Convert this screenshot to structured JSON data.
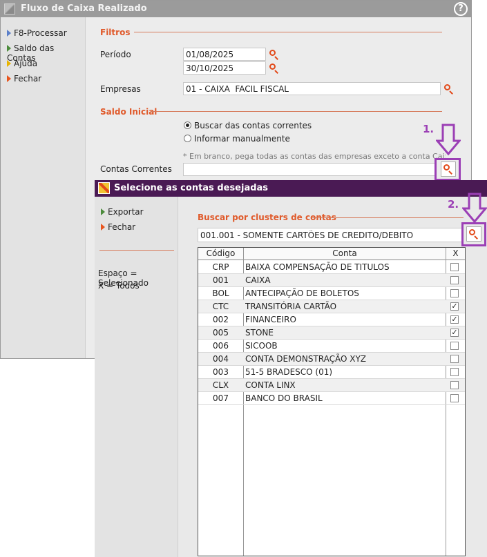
{
  "main": {
    "title": "Fluxo de Caixa Realizado",
    "help": "?",
    "sidebar": [
      {
        "label": "F8-Processar",
        "color": "#5b7fc9"
      },
      {
        "label": "Saldo das Contas",
        "color": "#4b8b3b"
      },
      {
        "label": "Ajuda",
        "color": "#e8b400"
      },
      {
        "label": "Fechar",
        "color": "#e8551e"
      }
    ],
    "filtros_title": "Filtros",
    "periodo_label": "Período",
    "data_inicio": "01/08/2025",
    "data_fim": "30/10/2025",
    "empresas_label": "Empresas",
    "empresas_value": "01 - CAIXA  FACIL FISCAL",
    "saldo_title": "Saldo Inicial",
    "radio_buscar": "Buscar das contas correntes",
    "radio_informar": "Informar manualmente",
    "hint": "* Em branco, pega todas as contas das empresas exceto a conta Caixa",
    "contas_label": "Contas Correntes",
    "contas_value": ""
  },
  "annotations": {
    "step1": "1.",
    "step2": "2."
  },
  "dialog": {
    "title": "Selecione as contas desejadas",
    "sidebar": [
      {
        "label": "Exportar",
        "color": "#4b8b3b"
      },
      {
        "label": "Fechar",
        "color": "#e8551e"
      }
    ],
    "legend_selected": "Espaço = Selecionado",
    "legend_all": "X = Todos",
    "cluster_title": "Buscar por clusters de contas",
    "cluster_value": "001.001 - SOMENTE CARTÕES DE CREDITO/DEBITO",
    "columns": {
      "code": "Código",
      "name": "Conta",
      "check": "X"
    },
    "rows": [
      {
        "code": "CRP",
        "name": "BAIXA COMPENSAÇÃO DE TITULOS",
        "checked": false
      },
      {
        "code": "001",
        "name": "CAIXA",
        "checked": false
      },
      {
        "code": "BOL",
        "name": "ANTECIPAÇÃO DE BOLETOS",
        "checked": false
      },
      {
        "code": "CTC",
        "name": "TRANSITÓRIA CARTÃO",
        "checked": true
      },
      {
        "code": "002",
        "name": "FINANCEIRO",
        "checked": true
      },
      {
        "code": "005",
        "name": "STONE",
        "checked": true
      },
      {
        "code": "006",
        "name": "SICOOB",
        "checked": false
      },
      {
        "code": "004",
        "name": "CONTA DEMONSTRAÇÃO XYZ",
        "checked": false
      },
      {
        "code": "003",
        "name": "51-5 BRADESCO (01)",
        "checked": false
      },
      {
        "code": "CLX",
        "name": "CONTA LINX",
        "checked": false
      },
      {
        "code": "007",
        "name": "BANCO DO BRASIL",
        "checked": false
      }
    ]
  }
}
